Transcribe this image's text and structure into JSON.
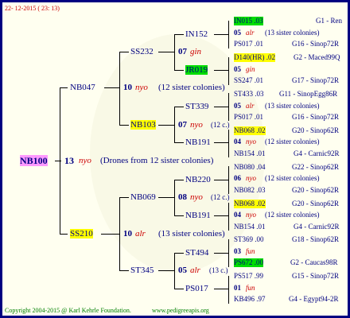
{
  "header": {
    "date": "22- 12-2015 ( 23: 13)"
  },
  "root": {
    "name": "NB100",
    "gen_num": "13",
    "gen_type": "nyo",
    "note": "(Drones from 12 sister colonies)"
  },
  "l1": [
    {
      "name": "NB047",
      "gen_num": "10",
      "gen_type": "nyo",
      "note": "(12 sister colonies)"
    },
    {
      "name": "SS210",
      "gen_num": "10",
      "gen_type": "alr",
      "note": "(13 sister colonies)"
    }
  ],
  "l2": [
    {
      "name": "SS232",
      "gen_num": "07",
      "gen_type": "gin"
    },
    {
      "name": "NB103",
      "gen_num": "07",
      "gen_type": "nyo",
      "note": "(12 c.)"
    },
    {
      "name": "NB069",
      "gen_num": "08",
      "gen_type": "nyo",
      "note": "(12 c.)"
    },
    {
      "name": "ST345",
      "gen_num": "05",
      "gen_type": "alr",
      "note": "(13 c.)"
    }
  ],
  "l3": [
    "IN152",
    "JR019",
    "ST339",
    "NB191",
    "NB220",
    "NB191",
    "ST494",
    "PS017"
  ],
  "right": [
    {
      "code": "IN015 .03",
      "label": "G1 - Ren"
    },
    {
      "gen": "05",
      "type": "alr",
      "note": "(13 sister colonies)"
    },
    {
      "code": "PS017 .01",
      "label": "G16 - Sinop72R"
    },
    {
      "code": "D140(HR) .02",
      "label": "G2 - Maced99Q"
    },
    {
      "gen": "05",
      "type": "gin"
    },
    {
      "code": "SS247 .01",
      "label": "G17 - Sinop72R"
    },
    {
      "code": "ST433 .03",
      "label": "G11 - SinopEgg86R"
    },
    {
      "gen": "05",
      "type": "alr",
      "note": "(13 sister colonies)"
    },
    {
      "code": "PS017 .01",
      "label": "G16 - Sinop72R"
    },
    {
      "code": "NB068 .02",
      "label": "G20 - Sinop62R"
    },
    {
      "gen": "04",
      "type": "nyo",
      "note": "(12 sister colonies)"
    },
    {
      "code": "NB154 .01",
      "label": "G4 - Carnic92R"
    },
    {
      "code": "NB080 .04",
      "label": "G22 - Sinop62R"
    },
    {
      "gen": "06",
      "type": "nyo",
      "note": "(12 sister colonies)"
    },
    {
      "code": "NB082 .03",
      "label": "G20 - Sinop62R"
    },
    {
      "code": "NB068 .02",
      "label": "G20 - Sinop62R"
    },
    {
      "gen": "04",
      "type": "nyo",
      "note": "(12 sister colonies)"
    },
    {
      "code": "NB154 .01",
      "label": "G4 - Carnic92R"
    },
    {
      "code": "ST369 .00",
      "label": "G18 - Sinop62R"
    },
    {
      "gen": "03",
      "type": "fun"
    },
    {
      "code": "PS672 .00",
      "label": "G2 - Caucas98R"
    },
    {
      "code": "PS517 .99",
      "label": "G15 - Sinop72R"
    },
    {
      "gen": "01",
      "type": "fun"
    },
    {
      "code": "KB496 .97",
      "label": "G4 - Egypt94-2R"
    }
  ],
  "footer": {
    "copyright": "Copyright 2004-2015 @ Karl Kehrle Foundation.",
    "site": "www.pedigreeapis.org"
  },
  "colors": {
    "border": "#000080",
    "highlight": "#ffff00",
    "green": "#00dd00",
    "pink": "#ff99ff",
    "red": "#cc0000"
  }
}
